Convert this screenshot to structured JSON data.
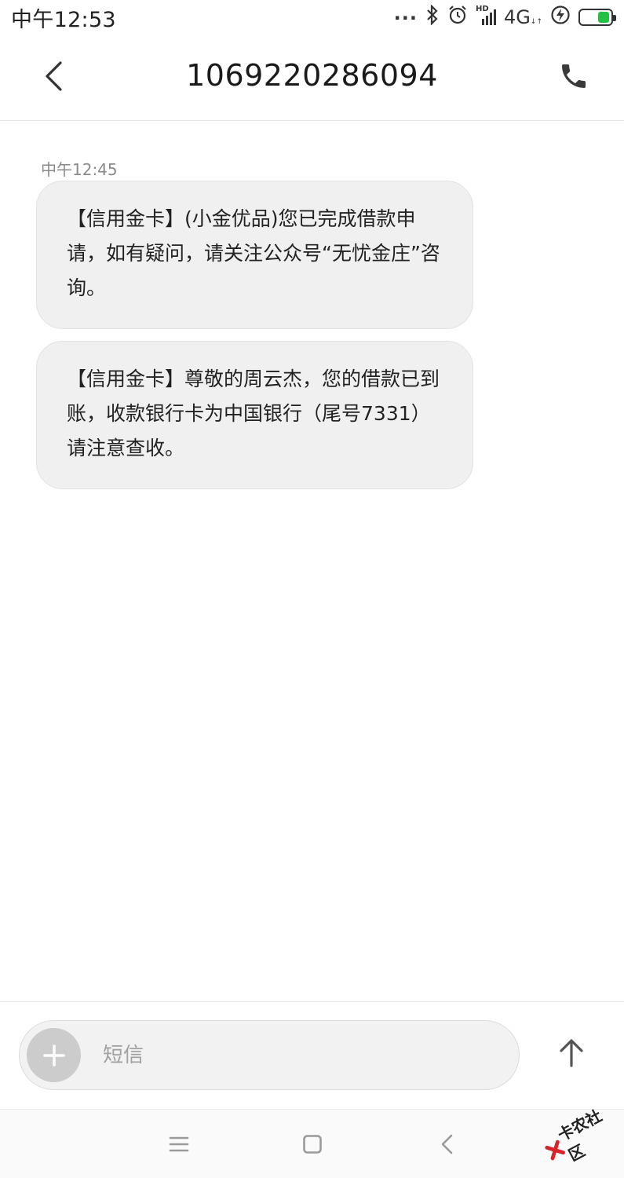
{
  "status_bar": {
    "time": "中午12:53",
    "more": "...",
    "hd": "HD",
    "network": "4G",
    "network_sub": "↓↑",
    "icons": [
      "bluetooth-icon",
      "alarm-icon",
      "signal-icon",
      "charging-icon",
      "battery-icon"
    ],
    "battery_color": "#25c043"
  },
  "header": {
    "title": "1069220286094",
    "back_icon": "chevron-left-icon",
    "call_icon": "phone-icon"
  },
  "conversation": {
    "timestamp": "中午12:45",
    "messages": [
      {
        "text": "【信用金卡】(小金优品)您已完成借款申请，如有疑问，请关注公众号“无忧金庄”咨询。"
      },
      {
        "text": "【信用金卡】尊敬的周云杰，您的借款已到账，收款银行卡为中国银行（尾号7331）请注意查收。"
      }
    ]
  },
  "composer": {
    "placeholder": "短信",
    "value": "",
    "add_icon": "plus-icon",
    "send_icon": "arrow-up-icon"
  },
  "nav_bar": {
    "icons": [
      "menu-icon",
      "home-icon",
      "back-icon"
    ]
  },
  "watermark": {
    "text": "卡农社区",
    "color": "#d8232a"
  }
}
